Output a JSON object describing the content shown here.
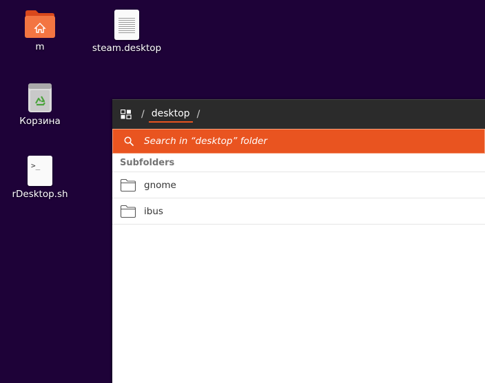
{
  "desktop": {
    "background": "#1e0238",
    "icons": [
      {
        "label": "m",
        "icon": "home-folder-icon"
      },
      {
        "label": "steam.desktop",
        "icon": "document-icon"
      },
      {
        "label": "Корзина",
        "icon": "trash-icon"
      },
      {
        "label": "rDesktop.sh",
        "icon": "terminal-script-icon",
        "glyph": ">_"
      }
    ]
  },
  "file_chooser": {
    "breadcrumb": {
      "separator": "/",
      "current": "desktop",
      "trailing_separator": "/"
    },
    "search": {
      "placeholder": "Search in “desktop” folder",
      "accent": "#e95420"
    },
    "section_title": "Subfolders",
    "folders": [
      {
        "name": "gnome"
      },
      {
        "name": "ibus"
      }
    ]
  }
}
